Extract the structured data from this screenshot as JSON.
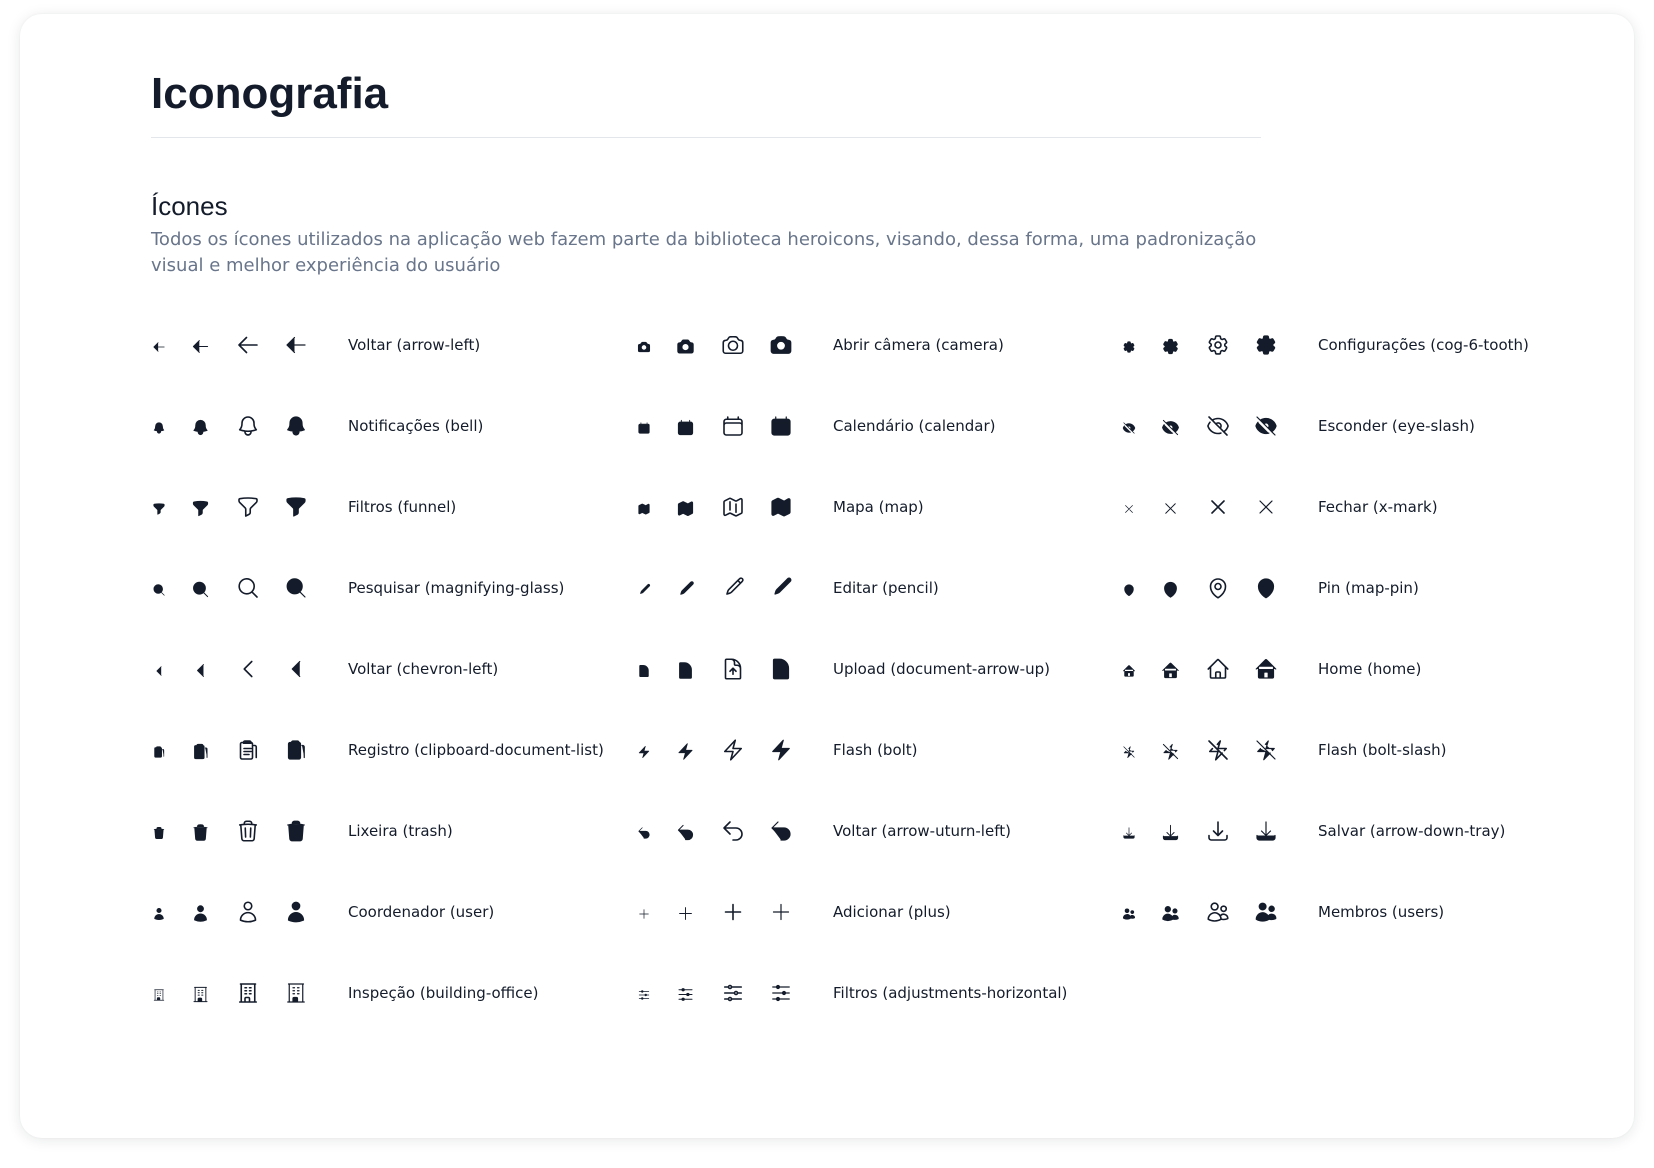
{
  "page": {
    "title": "Iconografia",
    "section_title": "Ícones",
    "section_description": "Todos os ícones utilizados na aplicação web fazem parte da biblioteca heroicons, visando, dessa forma, uma padronização visual e melhor experiência do usuário"
  },
  "icon_style": {
    "color": "#141c2b",
    "variants": [
      "mini",
      "micro-solid",
      "outline",
      "solid"
    ]
  },
  "icons": [
    {
      "icon": "arrow-left",
      "label": "Voltar (arrow-left)"
    },
    {
      "icon": "bell",
      "label": "Notificações (bell)"
    },
    {
      "icon": "funnel",
      "label": "Filtros (funnel)"
    },
    {
      "icon": "magnifying-glass",
      "label": "Pesquisar (magnifying-glass)"
    },
    {
      "icon": "chevron-left",
      "label": "Voltar (chevron-left)"
    },
    {
      "icon": "clipboard-document-list",
      "label": "Registro (clipboard-document-list)"
    },
    {
      "icon": "trash",
      "label": "Lixeira (trash)"
    },
    {
      "icon": "user",
      "label": "Coordenador (user)"
    },
    {
      "icon": "building-office",
      "label": "Inspeção (building-office)"
    },
    {
      "icon": "camera",
      "label": "Abrir câmera (camera)"
    },
    {
      "icon": "calendar",
      "label": "Calendário (calendar)"
    },
    {
      "icon": "map",
      "label": "Mapa (map)"
    },
    {
      "icon": "pencil",
      "label": "Editar (pencil)"
    },
    {
      "icon": "document-arrow-up",
      "label": "Upload (document-arrow-up)"
    },
    {
      "icon": "bolt",
      "label": "Flash (bolt)"
    },
    {
      "icon": "arrow-uturn-left",
      "label": "Voltar (arrow-uturn-left)"
    },
    {
      "icon": "plus",
      "label": "Adicionar (plus)"
    },
    {
      "icon": "adjustments-horizontal",
      "label": "Filtros (adjustments-horizontal)"
    },
    {
      "icon": "cog-6-tooth",
      "label": "Configurações (cog-6-tooth)"
    },
    {
      "icon": "eye-slash",
      "label": "Esconder (eye-slash)"
    },
    {
      "icon": "x-mark",
      "label": "Fechar (x-mark)"
    },
    {
      "icon": "map-pin",
      "label": "Pin (map-pin)"
    },
    {
      "icon": "home",
      "label": "Home (home)"
    },
    {
      "icon": "bolt-slash",
      "label": "Flash (bolt-slash)"
    },
    {
      "icon": "arrow-down-tray",
      "label": "Salvar (arrow-down-tray)"
    },
    {
      "icon": "users",
      "label": "Membros (users)"
    }
  ]
}
